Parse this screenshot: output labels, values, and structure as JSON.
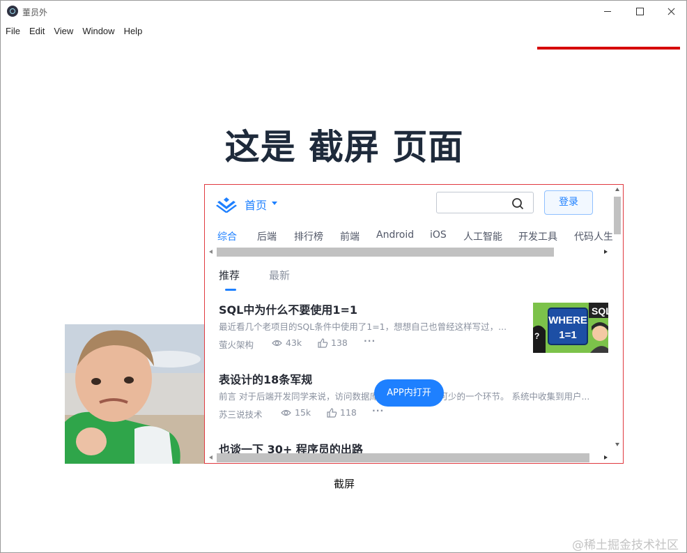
{
  "window": {
    "title": "董员外",
    "controls": {
      "minimize": "minimize",
      "maximize": "maximize",
      "close": "close"
    }
  },
  "menu": [
    "File",
    "Edit",
    "View",
    "Window",
    "Help"
  ],
  "page": {
    "heading": "这是 截屏 页面",
    "caption": "截屏"
  },
  "embedded": {
    "nav": {
      "home_label": "首页",
      "search_placeholder": "",
      "login_label": "登录"
    },
    "categories": [
      {
        "label": "综合",
        "active": true
      },
      {
        "label": "后端",
        "active": false
      },
      {
        "label": "排行榜",
        "active": false
      },
      {
        "label": "前端",
        "active": false
      },
      {
        "label": "Android",
        "active": false
      },
      {
        "label": "iOS",
        "active": false
      },
      {
        "label": "人工智能",
        "active": false
      },
      {
        "label": "开发工具",
        "active": false
      },
      {
        "label": "代码人生",
        "active": false
      }
    ],
    "tabs": [
      {
        "label": "推荐",
        "active": true
      },
      {
        "label": "最新",
        "active": false
      }
    ],
    "articles": [
      {
        "title": "SQL中为什么不要使用1=1",
        "abstract": "最近看几个老项目的SQL条件中使用了1=1，想想自己也曾经这样写过，...",
        "author": "萤火架构",
        "views": "43k",
        "likes": "138",
        "thumb_text": [
          "WHERE",
          "1=1",
          "SQL",
          "?"
        ]
      },
      {
        "title": "表设计的18条军规",
        "abstract": "前言 对于后端开发同学来说，访问数据库，是代码中必不可少的一个环节。 系统中收集到用户...",
        "author": "苏三说技术",
        "views": "15k",
        "likes": "118"
      },
      {
        "title": "也谈一下 30+ 程序员的出路"
      }
    ],
    "app_open_label": "APP内打开"
  },
  "watermark": "@稀土掘金技术社区",
  "colors": {
    "accent": "#1e80ff",
    "frame_border": "#e0393f",
    "red_line": "#d60000",
    "heading": "#1e2a3b"
  },
  "icons": [
    "app-icon",
    "juejin-logo-icon",
    "search-icon",
    "eye-icon",
    "like-icon",
    "more-icon",
    "caret-down-icon"
  ]
}
